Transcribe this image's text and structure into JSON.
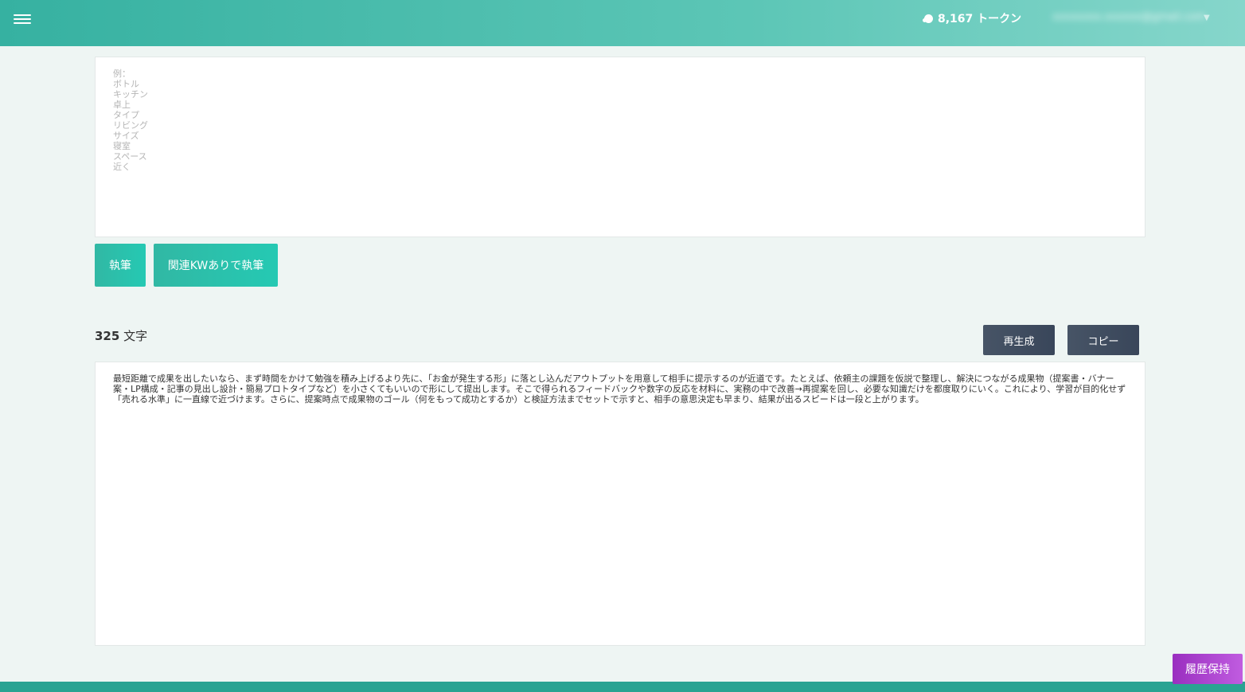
{
  "header": {
    "menu_icon": "hamburger-menu-icon",
    "token_icon": "token-bubble-icon",
    "token_label": "8,167 トークン",
    "user_email": "xxxxxxxx.xxxxxx@gmail.com",
    "user_menu_icon": "chevron-down-icon"
  },
  "keywords": {
    "placeholder": "例：\nボトル\nキッチン\n卓上\nタイプ\nリビング\nサイズ\n寝室\nスペース\n近く",
    "value": ""
  },
  "actions": {
    "write_label": "執筆",
    "write_with_kw_label": "関連KWありで執筆"
  },
  "result": {
    "count": "325",
    "count_unit": " 文字",
    "regenerate_label": "再生成",
    "copy_label": "コピー",
    "text": "最短距離で成果を出したいなら、まず時間をかけて勉強を積み上げるより先に、「お金が発生する形」に落とし込んだアウトプットを用意して相手に提示するのが近道です。たとえば、依頼主の課題を仮説で整理し、解決につながる成果物（提案書・バナー案・LP構成・記事の見出し設計・簡易プロトタイプなど）を小さくてもいいので形にして提出します。そこで得られるフィードバックや数字の反応を材料に、実務の中で改善→再提案を回し、必要な知識だけを都度取りにいく。これにより、学習が目的化せず「売れる水準」に一直線で近づけます。さらに、提案時点で成果物のゴール（何をもって成功とするか）と検証方法までセットで示すと、相手の意思決定も早まり、結果が出るスピードは一段と上がります。"
  },
  "footer": {
    "history_label": "履歴保持"
  },
  "colors": {
    "header_start": "#36b1a1",
    "accent_teal": "#25c9b3",
    "dark_button": "#39465a",
    "history_purple": "#9a2fc0",
    "background": "#eef5f3"
  }
}
